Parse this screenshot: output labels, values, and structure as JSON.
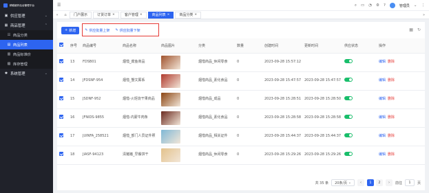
{
  "app": {
    "title": "精耕细作后台管理平台"
  },
  "sidebar": {
    "menus": [
      {
        "icon": "store-icon",
        "glyph": "▣",
        "label": "供应管理",
        "expanded": false
      },
      {
        "icon": "goods-icon",
        "glyph": "▦",
        "label": "商品管理",
        "expanded": true,
        "children": [
          {
            "icon": "category-icon",
            "glyph": "☷",
            "label": "商品分类",
            "active": false
          },
          {
            "icon": "list-icon",
            "glyph": "▤",
            "label": "商品列表",
            "active": true
          },
          {
            "icon": "price-icon",
            "glyph": "▥",
            "label": "商品标准价",
            "active": false
          },
          {
            "icon": "stock-icon",
            "glyph": "▧",
            "label": "库存管理",
            "active": false
          }
        ]
      },
      {
        "icon": "settings-icon",
        "glyph": "✱",
        "label": "系统管理",
        "expanded": false
      }
    ]
  },
  "topbar": {
    "user": "管理员"
  },
  "tabs": [
    {
      "label": "门户展示",
      "closable": false,
      "active": false
    },
    {
      "label": "订货订单",
      "closable": true,
      "active": false
    },
    {
      "label": "客户管理",
      "closable": true,
      "active": false
    },
    {
      "label": "商品列表",
      "closable": true,
      "active": true
    },
    {
      "label": "商品分类",
      "closable": true,
      "active": false
    }
  ],
  "toolbar": {
    "add_label": "新增",
    "batch_on_label": "供应批量上架",
    "batch_off_label": "供应批量下架"
  },
  "table": {
    "headers": [
      "",
      "序号",
      "商品编号",
      "商品名称",
      "商品图片",
      "分类",
      "数量",
      "创建时间",
      "更新时间",
      "供应状态",
      "操作"
    ],
    "edit_label": "编辑",
    "delete_label": "删除",
    "rows": [
      {
        "no": "13",
        "code": "FDSB01",
        "name": "烟惜_腐鱼商品",
        "category": "烟惜商品_休闲零食",
        "qty": "0",
        "created": "2023-09-28 15:57:12",
        "updated": "",
        "status": true,
        "img_color": "#a0522d"
      },
      {
        "no": "14",
        "code": "JFDSNF-954",
        "name": "烟惜_蟹文厮系",
        "category": "烟惜商品_素化食品",
        "qty": "0",
        "created": "2023-09-28 15:47:57",
        "updated": "2023-09-28 15:47:57",
        "status": true,
        "img_color": "#b03a2e"
      },
      {
        "no": "15",
        "code": "JSDNF-952",
        "name": "烟惜-火炬烧干果商品",
        "category": "烟惜商品_成品",
        "qty": "0",
        "created": "2023-09-28 15:28:51",
        "updated": "2023-09-28 15:28:50",
        "status": true,
        "img_color": "#8b4513"
      },
      {
        "no": "16",
        "code": "JFNIDS-9855",
        "name": "烟惜-内蒙牛肉条",
        "category": "烟惜商品_素化食品",
        "qty": "0",
        "created": "2023-09-28 15:28:58",
        "updated": "2023-09-28 15:28:58",
        "status": true,
        "img_color": "#6b2a1f"
      },
      {
        "no": "17",
        "code": "JUINFA_258521",
        "name": "烟惜_部门人员证件照",
        "category": "烟惜商品_相关证件",
        "qty": "0",
        "created": "2023-09-28 15:44:37",
        "updated": "2023-09-28 15:44:37",
        "status": true,
        "img_color": "#7fb8d6"
      },
      {
        "no": "18",
        "code": "JIASF-94123",
        "name": "清猪猪_早餐饼干",
        "category": "烟惜商品_休闲零食",
        "qty": "0",
        "created": "2023-09-28 15:29:26",
        "updated": "2023-09-28 15:29:26",
        "status": true,
        "img_color": "#e3c28c"
      }
    ]
  },
  "pagination": {
    "total": "共 35 条",
    "page_size": "20条/页",
    "pages": [
      "1",
      "2"
    ],
    "current": "1",
    "goto_label": "前往",
    "goto_value": "1",
    "page_suffix": "页"
  }
}
